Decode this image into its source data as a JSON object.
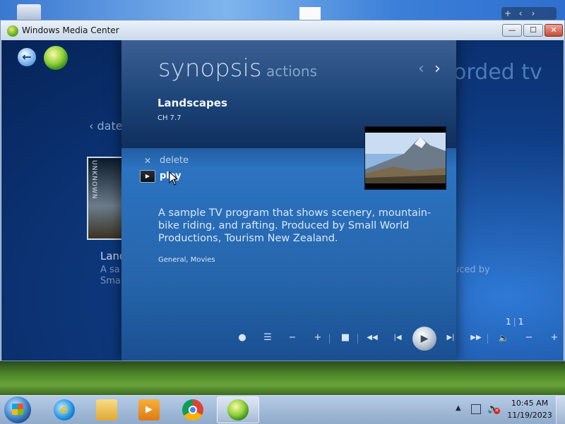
{
  "window": {
    "title": "Windows Media Center",
    "minimize_glyph": "—",
    "maximize_glyph": "☐",
    "close_glyph": "✕"
  },
  "desktop": {
    "gadget_controls": [
      "+",
      "‹",
      "›"
    ]
  },
  "background": {
    "heading": "orded tv",
    "date_nav": "‹ date",
    "thumb_text": "UNKNOWN",
    "item_title": "Land",
    "desc_line1": "A sa",
    "desc_line2": "Smal",
    "desc_right": "uced by"
  },
  "synopsis": {
    "tab_active": "synopsis",
    "tab_inactive": "actions",
    "nav_prev": "‹",
    "nav_next": "›",
    "program_title": "Landscapes",
    "channel": "CH 7.7",
    "actions": {
      "delete_label": "delete",
      "delete_glyph": "✕",
      "play_label": "play",
      "play_glyph": "▶"
    },
    "description": "A sample TV program that shows scenery, mountain-bike riding, and rafting. Produced by Small World Productions, Tourism New Zealand.",
    "genres": "General, Movies"
  },
  "pagination": {
    "current": "1",
    "total": "1"
  },
  "transport": {
    "record": "●",
    "guide": "☰",
    "channel_down": "−",
    "channel_up": "+",
    "stop": "■",
    "rewind": "◀◀",
    "skip_back": "|◀",
    "play": "▶",
    "skip_forward": "▶|",
    "fast_forward": "▶▶",
    "mute": "🔈",
    "volume_down": "−",
    "volume_up": "+"
  },
  "taskbar": {
    "ie_glyph": "e",
    "media_glyph": "▶",
    "tray_arrow": "▲",
    "clock_time": "10:45 AM",
    "clock_date": "11/19/2023"
  }
}
